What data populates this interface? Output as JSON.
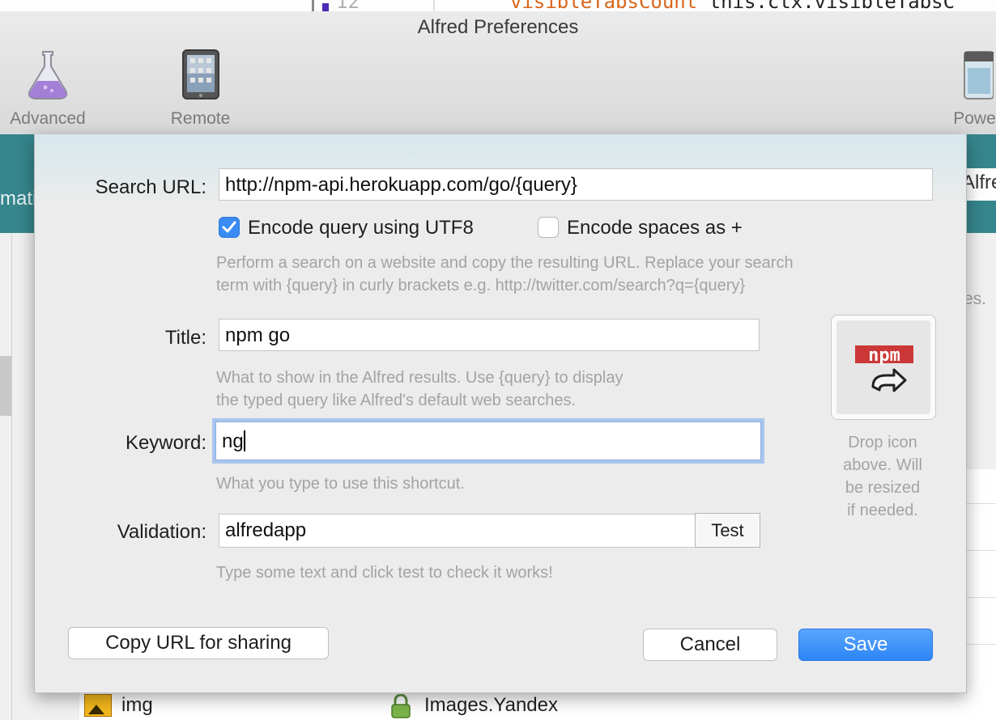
{
  "window": {
    "title": "Alfred Preferences"
  },
  "toolbar": {
    "items": [
      {
        "label": "Advanced",
        "icon": "flask-icon"
      },
      {
        "label": "Remote",
        "icon": "tablet-icon"
      },
      {
        "label": "Power",
        "icon": "powerpack-icon"
      }
    ]
  },
  "background": {
    "code_line_number": "12",
    "code_text_highlight": "visibleTabsCount",
    "code_text_rest": " this.ctx.visibleTabsC",
    "teal_left_text": "mati",
    "alfred_field_text": "Alfre",
    "right_text": "es.",
    "row": {
      "name": "img",
      "site": "Images.Yandex"
    }
  },
  "form": {
    "search_url": {
      "label": "Search URL:",
      "value": "http://npm-api.herokuapp.com/go/{query}"
    },
    "encode_utf8": {
      "label": "Encode query using UTF8",
      "checked": true
    },
    "encode_spaces": {
      "label": "Encode spaces as +",
      "checked": false
    },
    "search_url_help_1": "Perform a search on a website and copy the resulting URL. Replace your search",
    "search_url_help_2": "term with {query} in curly brackets e.g. http://twitter.com/search?q={query}",
    "title": {
      "label": "Title:",
      "value": "npm go"
    },
    "title_help_1": "What to show in the Alfred results. Use {query} to display",
    "title_help_2": "the typed query like Alfred's default web searches.",
    "keyword": {
      "label": "Keyword:",
      "value": "ng"
    },
    "keyword_help": "What you type to use this shortcut.",
    "validation": {
      "label": "Validation:",
      "value": "alfredapp",
      "test_label": "Test"
    },
    "validation_help": "Type some text and click test to check it works!",
    "icon": {
      "badge_text": "npm",
      "drop_text_1": "Drop icon",
      "drop_text_2": "above. Will",
      "drop_text_3": "be resized",
      "drop_text_4": "if needed."
    }
  },
  "buttons": {
    "copy_url": "Copy URL for sharing",
    "cancel": "Cancel",
    "save": "Save"
  },
  "colors": {
    "accent": "#3a8bf3",
    "teal": "#36868d",
    "npm_red": "#cb3837"
  }
}
